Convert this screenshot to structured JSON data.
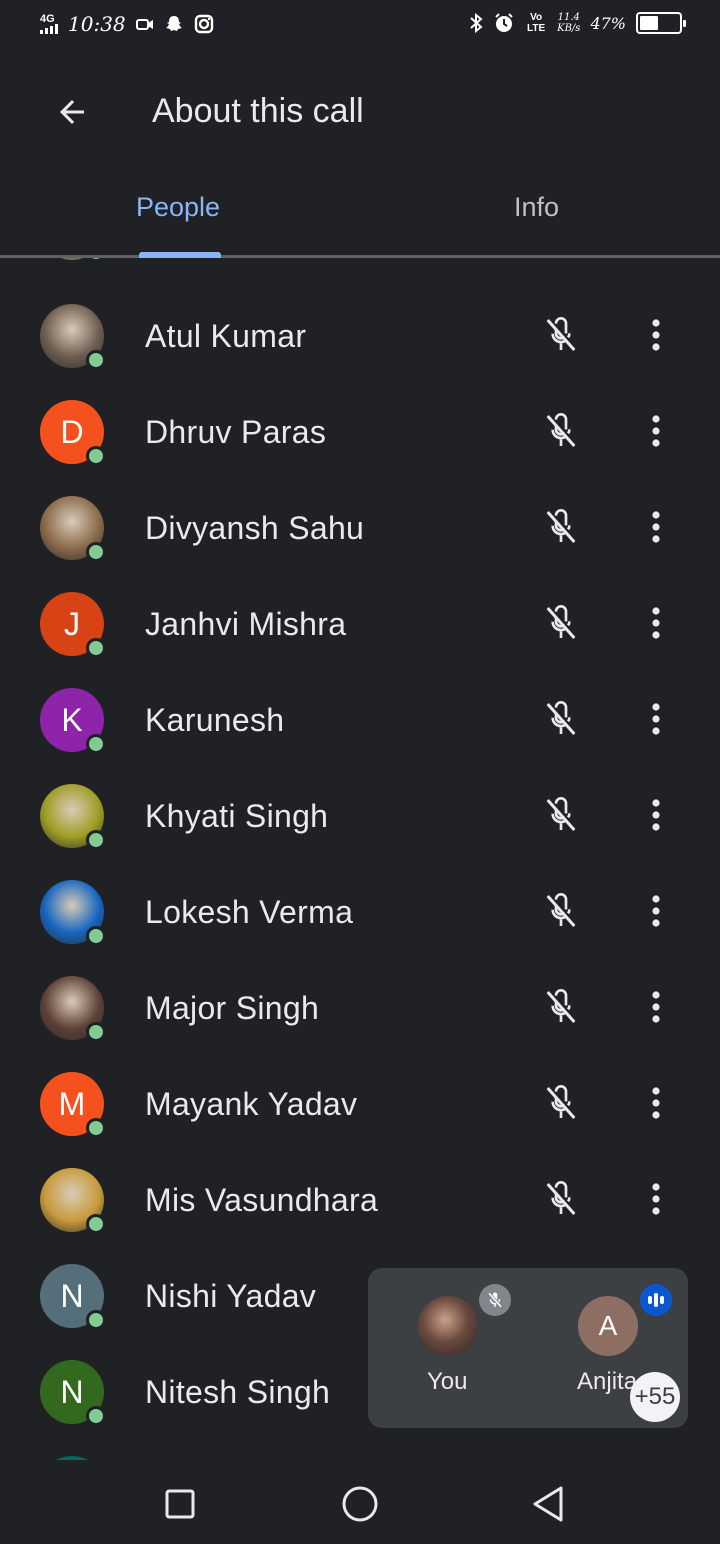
{
  "status_bar": {
    "network": "4G",
    "time": "10:38",
    "speed_value": "11.4",
    "speed_unit": "KB/s",
    "volte": "Vo LTE",
    "battery_pct": "47%",
    "battery_level": 0.47
  },
  "header": {
    "title": "About this call"
  },
  "tabs": [
    {
      "label": "People",
      "active": true
    },
    {
      "label": "Info",
      "active": false
    }
  ],
  "participants": [
    {
      "name": "Atul Kumar",
      "initial": "",
      "avatar_color": "#6d5d50",
      "photo": true
    },
    {
      "name": "Dhruv Paras",
      "initial": "D",
      "avatar_color": "#f4511e",
      "photo": false
    },
    {
      "name": "Divyansh Sahu",
      "initial": "",
      "avatar_color": "#8a6a4a",
      "photo": true
    },
    {
      "name": "Janhvi Mishra",
      "initial": "J",
      "avatar_color": "#d84315",
      "photo": false
    },
    {
      "name": "Karunesh",
      "initial": "K",
      "avatar_color": "#8e24aa",
      "photo": false
    },
    {
      "name": "Khyati Singh",
      "initial": "",
      "avatar_color": "#9e9d24",
      "photo": true
    },
    {
      "name": "Lokesh Verma",
      "initial": "",
      "avatar_color": "#1565c0",
      "photo": true
    },
    {
      "name": "Major Singh",
      "initial": "",
      "avatar_color": "#5d4037",
      "photo": true
    },
    {
      "name": "Mayank Yadav",
      "initial": "M",
      "avatar_color": "#f4511e",
      "photo": false
    },
    {
      "name": "Mis Vasundhara",
      "initial": "",
      "avatar_color": "#c79a3b",
      "photo": true
    },
    {
      "name": "Nishi Yadav",
      "initial": "N",
      "avatar_color": "#546e7a",
      "photo": false
    },
    {
      "name": "Nitesh Singh",
      "initial": "N",
      "avatar_color": "#33691e",
      "photo": false
    }
  ],
  "call_card": {
    "self_label": "You",
    "other_label": "Anjita",
    "other_initial": "A",
    "overflow_count": "+55"
  },
  "colors": {
    "background": "#202124",
    "accent": "#8ab4f8",
    "presence": "#81c995"
  },
  "icons": {
    "back": "arrow-left-icon",
    "mic_off": "mic-off-icon",
    "more": "more-vert-icon",
    "speaking": "audio-level-icon"
  }
}
